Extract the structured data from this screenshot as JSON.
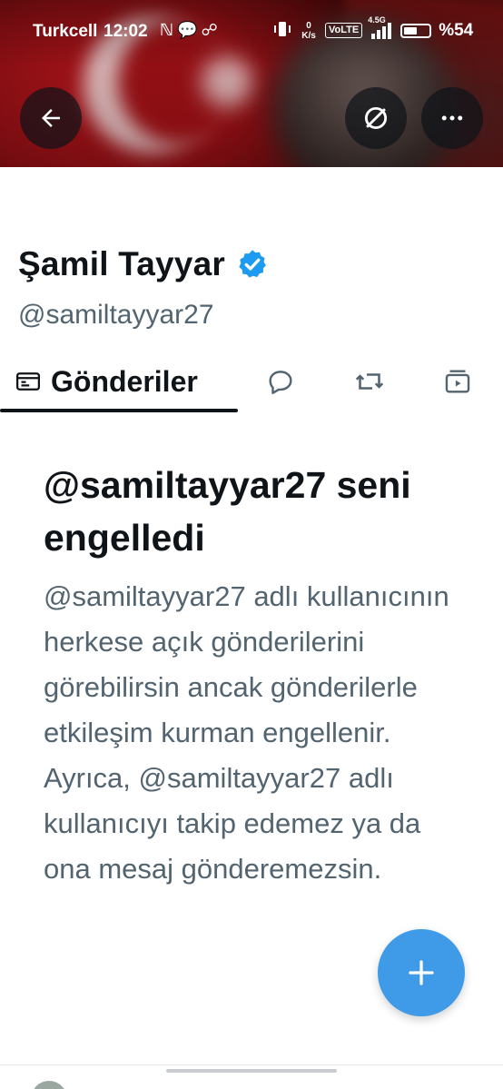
{
  "status_bar": {
    "carrier": "Turkcell",
    "time": "12:02",
    "network_speed": "0 K/s",
    "volte": "VoLTE",
    "network_type": "4.5G",
    "battery_percent": "%54",
    "battery_level": 0.54
  },
  "profile": {
    "display_name": "Şamil Tayyar",
    "handle": "@samiltayyar27",
    "verified": true
  },
  "tabs": [
    {
      "label": "Gönderiler",
      "icon": "posts-icon",
      "active": true
    },
    {
      "label": "",
      "icon": "reply-icon",
      "active": false
    },
    {
      "label": "",
      "icon": "repost-icon",
      "active": false
    },
    {
      "label": "",
      "icon": "media-icon",
      "active": false
    }
  ],
  "block_notice": {
    "title": "@samiltayyar27 seni engelledi",
    "body": "@samiltayyar27 adlı kullanıcının herkese açık gönderilerini görebilirsin ancak gönderilerle etkileşim kurman engellenir. Ayrıca, @samiltayyar27 adlı kullanıcıyı takip edemez ya da ona mesaj gönderemezsin."
  },
  "colors": {
    "accent": "#1d9bf0",
    "fab": "#3f9ae8",
    "text_primary": "#0f1419",
    "text_secondary": "#536471"
  }
}
